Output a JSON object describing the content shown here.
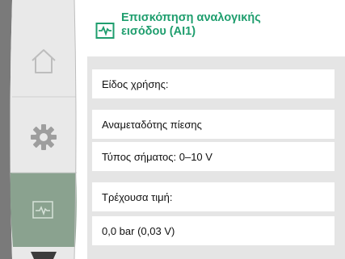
{
  "header": {
    "title_line1": "Επισκόπηση αναλογικής",
    "title_line2": "εισόδου (AI1)",
    "icon": "analog-signal-icon"
  },
  "sidebar": {
    "items": [
      {
        "icon": "home-icon"
      },
      {
        "icon": "gear-icon"
      },
      {
        "icon": "analog-signal-icon",
        "selected": true
      }
    ],
    "accent_colors": {
      "selected_bg": "#8aa28f",
      "panel_bg": "#e9e9e9"
    }
  },
  "rows": [
    "Είδος χρήσης:",
    "Αναμεταδότης πίεσης",
    "Τύπος σήματος: 0–10 V",
    "Τρέχουσα τιμή:",
    "0,0 bar (0,03 V)"
  ],
  "colors": {
    "title": "#1f9e6e",
    "content_bg": "#e5e5e5"
  }
}
